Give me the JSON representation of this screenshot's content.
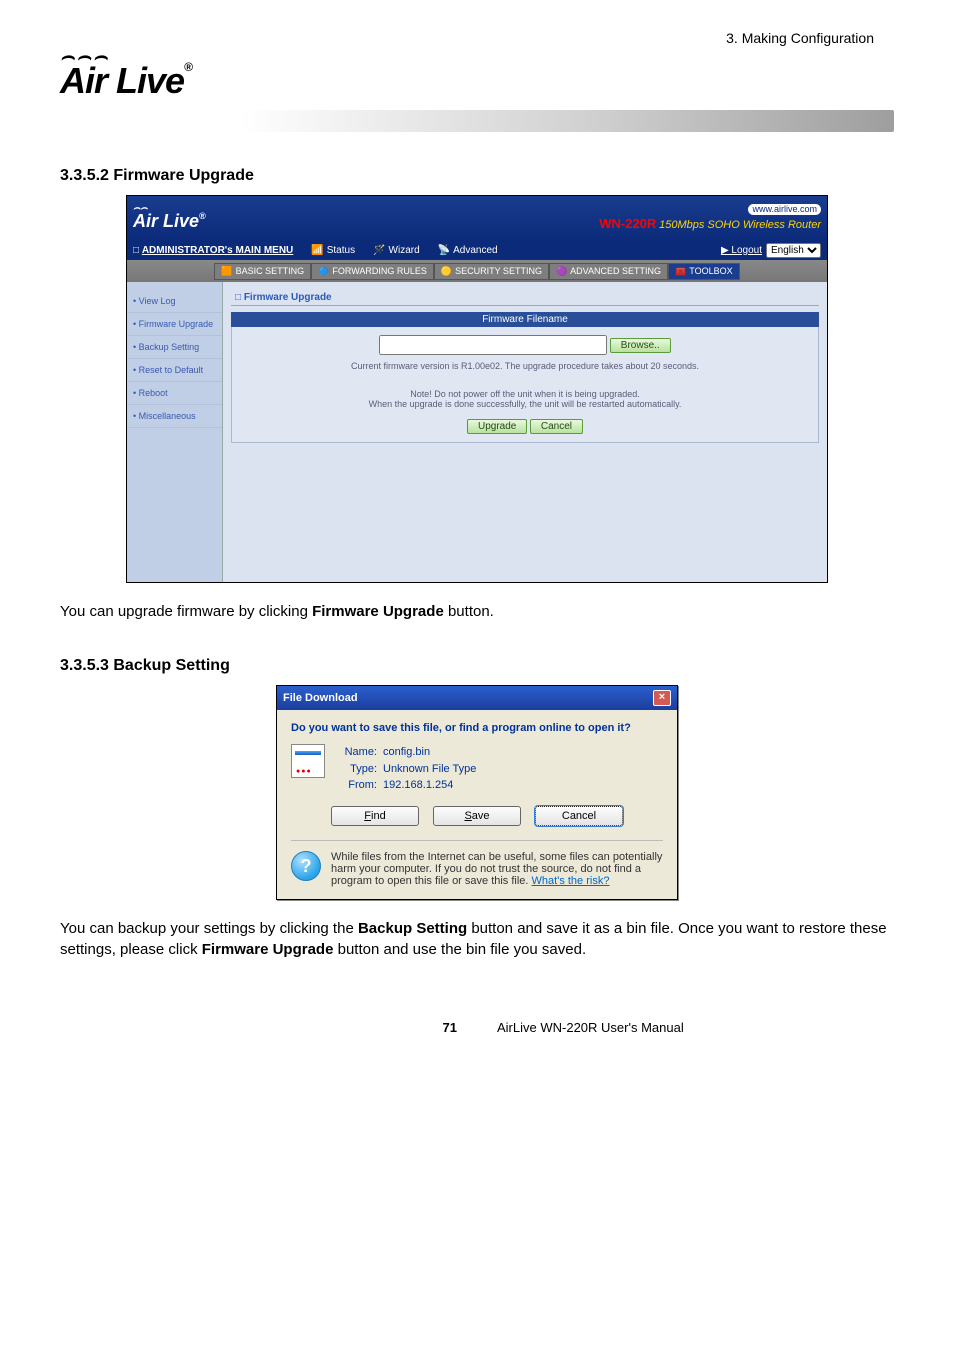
{
  "chapter": "3.  Making  Configuration",
  "logo_text": "Air Live",
  "logo_reg": "®",
  "section1": {
    "heading": "3.3.5.2  Firmware Upgrade"
  },
  "ss1": {
    "logo": "Air Live",
    "url": "www.airlive.com",
    "model": "WN-220R",
    "tagline": "150Mbps SOHO Wireless Router",
    "admin_menu": "ADMINISTRATOR's MAIN MENU",
    "menu_status": "Status",
    "menu_wizard": "Wizard",
    "menu_advanced": "Advanced",
    "logout": "▶ Logout",
    "lang": "English",
    "tabs": {
      "basic": "BASIC SETTING",
      "forwarding": "FORWARDING RULES",
      "security": "SECURITY SETTING",
      "advanced": "ADVANCED SETTING",
      "toolbox": "TOOLBOX"
    },
    "side": {
      "viewlog": "• View Log",
      "fw": "• Firmware Upgrade",
      "backup": "• Backup Setting",
      "reset": "• Reset to Default",
      "reboot": "• Reboot",
      "misc": "• Miscellaneous"
    },
    "panel": {
      "title": "□ Firmware Upgrade",
      "header": "Firmware Filename",
      "browse": "Browse..",
      "version": "Current firmware version is R1.00e02. The upgrade procedure takes about 20 seconds.",
      "note": "Note! Do not power off the unit when it is being upgraded.",
      "done": "When the upgrade is done successfully, the unit will be restarted automatically.",
      "upgrade": "Upgrade",
      "cancel": "Cancel"
    }
  },
  "paragraph1_a": "You can upgrade firmware by clicking ",
  "paragraph1_b": "Firmware Upgrade",
  "paragraph1_c": " button.",
  "section2": {
    "heading": "3.3.5.3  Backup Setting"
  },
  "ss2": {
    "title": "File Download",
    "question": "Do you want to save this file, or find a program online to open it?",
    "name_lbl": "Name:",
    "name_val": "config.bin",
    "type_lbl": "Type:",
    "type_val": "Unknown File Type",
    "from_lbl": "From:",
    "from_val": "192.168.1.254",
    "find": "Find",
    "save": "Save",
    "cancel": "Cancel",
    "warn": "While files from the Internet can be useful, some files can potentially harm your computer. If you do not trust the source, do not find a program to open this file or save this file. ",
    "risk": "What's the risk?"
  },
  "paragraph2_a": "You can backup your settings by clicking the ",
  "paragraph2_b": "Backup Setting",
  "paragraph2_c": " button and save it as a bin file. Once you want to restore these settings, please click ",
  "paragraph2_d": "Firmware Upgrade",
  "paragraph2_e": " button and use the bin file you saved.",
  "footer": {
    "page": "71",
    "manual": "AirLive  WN-220R  User's  Manual"
  }
}
